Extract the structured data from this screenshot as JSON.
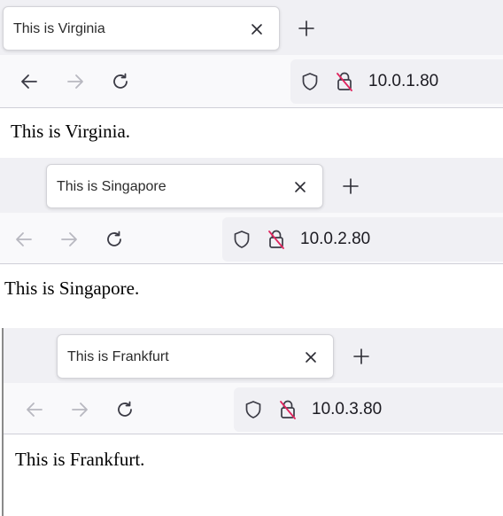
{
  "windows": [
    {
      "tab_title": "This is Virginia",
      "url": "10.0.1.80",
      "page_text": "This is Virginia."
    },
    {
      "tab_title": "This is Singapore",
      "url": "10.0.2.80",
      "page_text": "This is Singapore."
    },
    {
      "tab_title": "This is Frankfurt",
      "url": "10.0.3.80",
      "page_text": "This is Frankfurt."
    }
  ],
  "icons": {
    "tab_close": "close-icon",
    "new_tab": "plus-icon",
    "back": "arrow-left-icon",
    "forward": "arrow-right-icon",
    "reload": "reload-icon",
    "tracking_protection": "shield-icon",
    "connection": "insecure-lock-icon"
  },
  "colors": {
    "tabbar_bg": "#f0f0f4",
    "toolbar_bg": "#f9f9fb",
    "icon": "#3b3b45",
    "icon_disabled": "#b8b8c0",
    "insecure_slash": "#e0245e"
  }
}
